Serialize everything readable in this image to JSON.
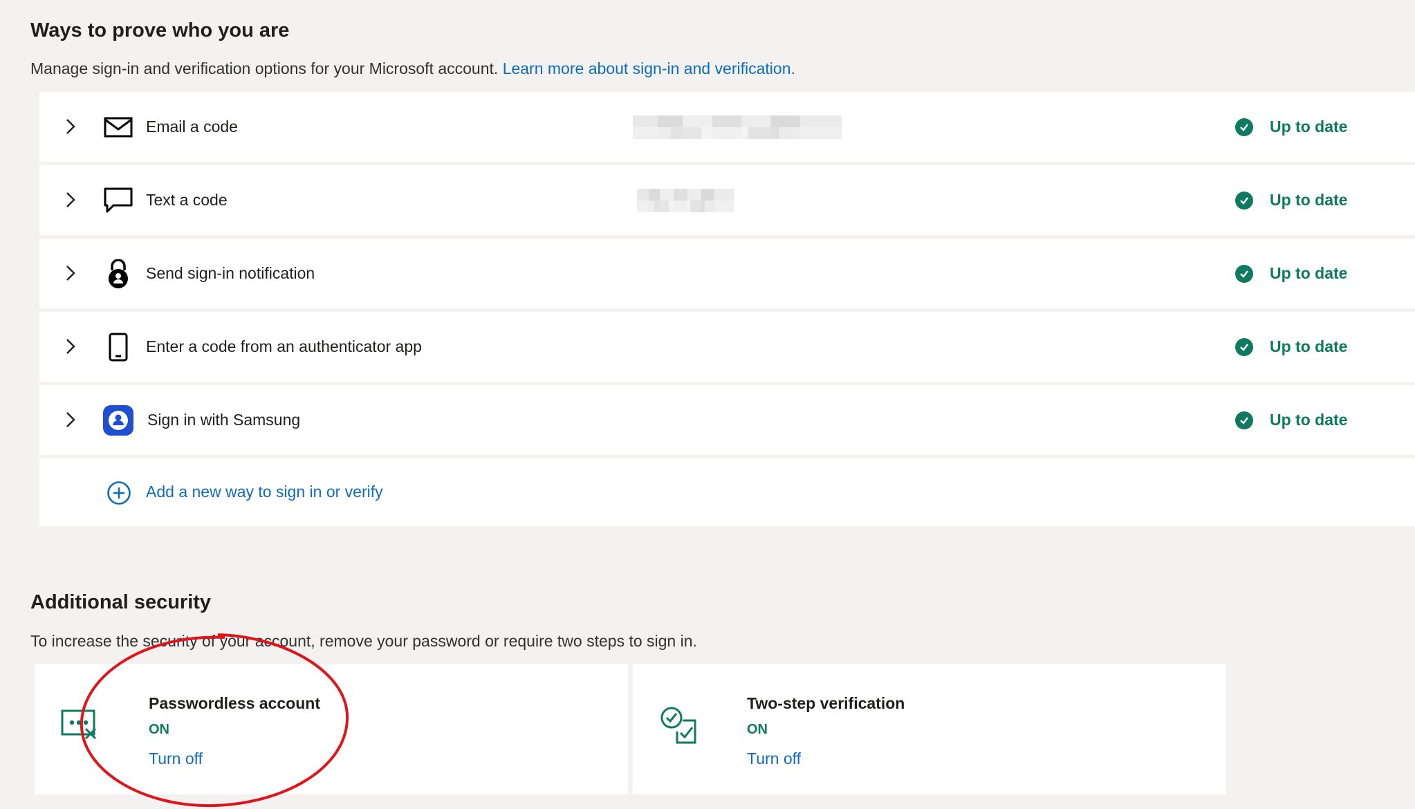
{
  "section_ways": {
    "title": "Ways to prove who you are",
    "description": "Manage sign-in and verification options for your Microsoft account.",
    "learn_more_link": "Learn more about sign-in and verification."
  },
  "methods": [
    {
      "label": "Email a code",
      "icon": "mail-icon",
      "status": "Up to date"
    },
    {
      "label": "Text a code",
      "icon": "chat-icon",
      "status": "Up to date"
    },
    {
      "label": "Send sign-in notification",
      "icon": "lock-person-icon",
      "status": "Up to date"
    },
    {
      "label": "Enter a code from an authenticator app",
      "icon": "phone-icon",
      "status": "Up to date"
    },
    {
      "label": "Sign in with Samsung",
      "icon": "samsung-person-icon",
      "status": "Up to date"
    }
  ],
  "add_method": {
    "label": "Add a new way to sign in or verify",
    "icon": "add-circle-icon"
  },
  "section_additional": {
    "title": "Additional security",
    "description": "To increase the security of your account, remove your password or require two steps to sign in."
  },
  "cards": {
    "passwordless": {
      "title": "Passwordless account",
      "status": "ON",
      "action": "Turn off",
      "icon": "password-off-icon"
    },
    "twostep": {
      "title": "Two-step verification",
      "status": "ON",
      "action": "Turn off",
      "icon": "two-step-check-icon"
    }
  },
  "colors": {
    "accent_link": "#0f6cbd",
    "status_green": "#0e7a5f",
    "background": "#f3f2f1",
    "annotation_red": "#e0141b"
  }
}
